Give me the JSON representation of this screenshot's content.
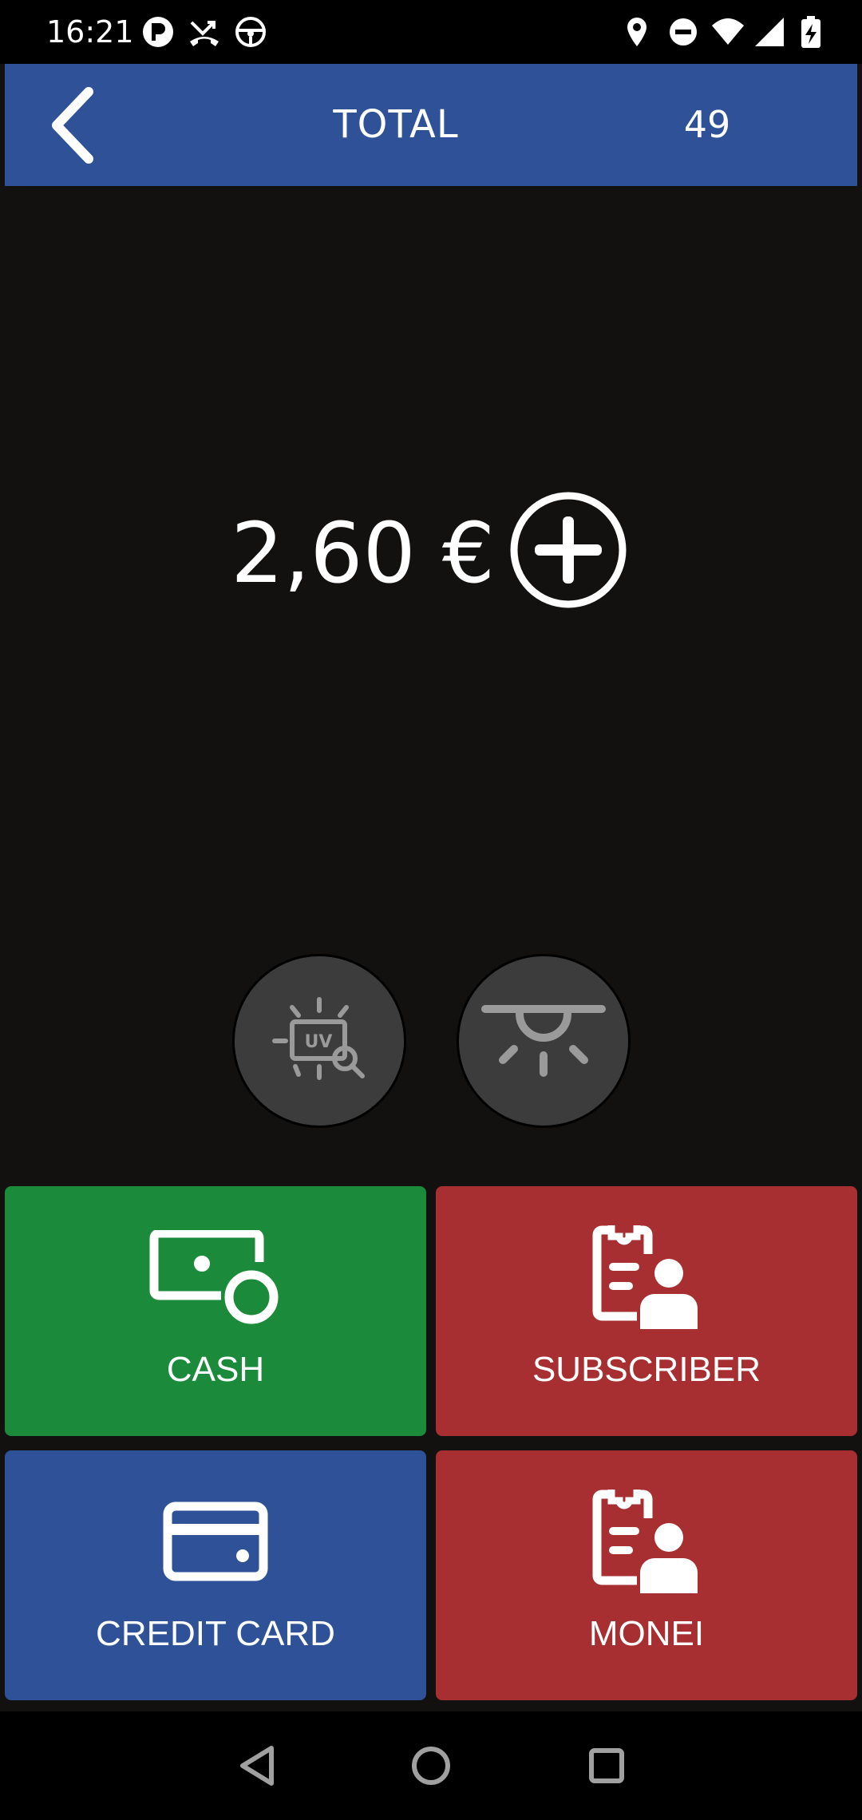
{
  "status_bar": {
    "time": "16:21",
    "left_icons": [
      "notification-p-icon",
      "missed-call-icon",
      "driving-wheel-icon"
    ],
    "right_icons": [
      "location-icon",
      "do-not-disturb-icon",
      "wifi-icon",
      "signal-icon",
      "battery-charging-icon"
    ]
  },
  "header": {
    "title": "TOTAL",
    "count": "49",
    "back_icon": "chevron-left-icon"
  },
  "amount": {
    "value": "2,60 €",
    "add_icon": "plus-circle-icon"
  },
  "tools": [
    {
      "name": "uv-scan",
      "icon": "uv-scan-icon"
    },
    {
      "name": "light",
      "icon": "ceiling-light-icon"
    }
  ],
  "payments": [
    {
      "label": "CASH",
      "icon": "cash-icon",
      "color": "#1b8a3a"
    },
    {
      "label": "SUBSCRIBER",
      "icon": "subscriber-clipboard-icon",
      "color": "#a72e31"
    },
    {
      "label": "CREDIT CARD",
      "icon": "credit-card-icon",
      "color": "#2e5197"
    },
    {
      "label": "MONEI",
      "icon": "subscriber-clipboard-icon",
      "color": "#a72e31"
    }
  ],
  "nav_bar": {
    "icons": [
      "back-triangle-icon",
      "home-circle-icon",
      "recents-square-icon"
    ]
  },
  "colors": {
    "background": "#121110",
    "header": "#2e5197",
    "green": "#1b8a3a",
    "red": "#a72e31",
    "blue": "#2e5197",
    "round_button": "#3c3c3c"
  }
}
